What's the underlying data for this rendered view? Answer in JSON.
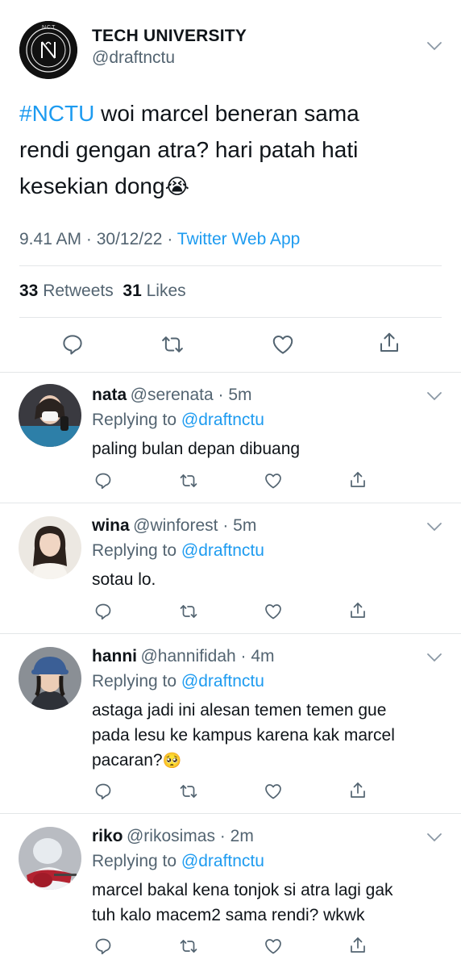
{
  "tweet": {
    "account_name": "TECH UNIVERSITY",
    "handle": "@draftnctu",
    "logo_text": "NCT",
    "hashtag": "#NCTU",
    "text_line1_rest": " woi marcel beneran sama",
    "text_line2": "rendi gengan atra? hari patah hati",
    "text_line3": "kesekian dong",
    "emoji": "😭",
    "time": "9.41 AM",
    "date": "30/12/22",
    "separator": " · ",
    "source": "Twitter Web App",
    "retweets_count": "33",
    "retweets_label": "Retweets",
    "likes_count": "31",
    "likes_label": "Likes"
  },
  "replies": [
    {
      "name": "nata",
      "handle": "@serenata",
      "time": "5m",
      "replying_label": "Replying to ",
      "replying_to": "@draftnctu",
      "lines": [
        "paling bulan depan dibuang"
      ]
    },
    {
      "name": "wina",
      "handle": "@winforest",
      "time": "5m",
      "replying_label": "Replying to ",
      "replying_to": "@draftnctu",
      "lines": [
        "sotau lo."
      ]
    },
    {
      "name": "hanni",
      "handle": "@hannifidah",
      "time": "4m",
      "replying_label": "Replying to ",
      "replying_to": "@draftnctu",
      "lines": [
        "astaga jadi ini alesan temen temen gue",
        "pada lesu ke kampus karena kak marcel",
        "pacaran?"
      ],
      "emoji": "🥺"
    },
    {
      "name": "riko",
      "handle": "@rikosimas",
      "time": "2m",
      "replying_label": "Replying to ",
      "replying_to": "@draftnctu",
      "lines": [
        "marcel bakal kena tonjok si atra lagi gak",
        "tuh kalo macem2 sama rendi? wkwk"
      ]
    }
  ],
  "dot": " · ",
  "colors": {
    "link": "#1d9bf0",
    "secondary": "#536471",
    "text": "#0f1419",
    "divider": "#e3e6e8"
  },
  "icons": [
    "reply-icon",
    "retweet-icon",
    "like-icon",
    "share-icon",
    "chevron-down-icon"
  ]
}
